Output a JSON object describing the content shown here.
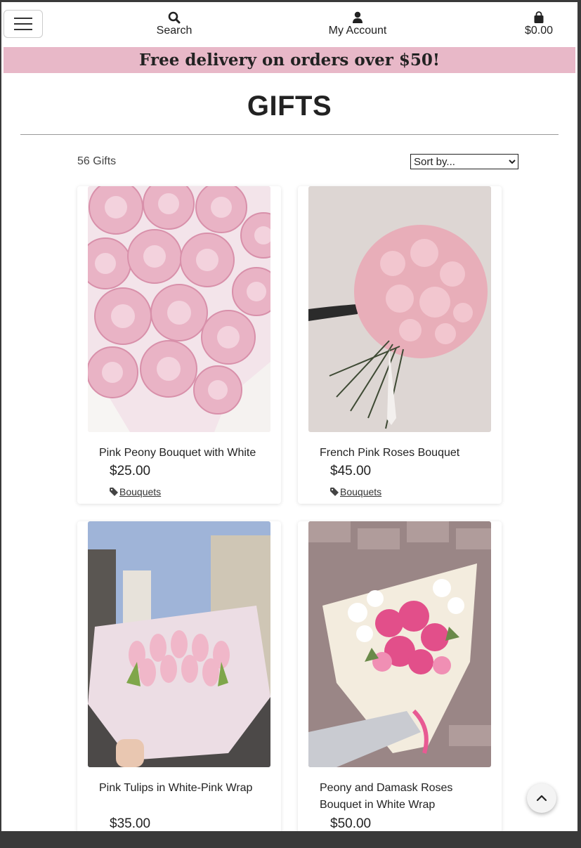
{
  "nav": {
    "search_label": "Search",
    "account_label": "My Account",
    "cart_total": "$0.00"
  },
  "promo": {
    "text": "Free delivery on orders over $50!"
  },
  "page": {
    "title": "GIFTS",
    "count": "56 Gifts"
  },
  "sort": {
    "selected": "Sort by..."
  },
  "products": [
    {
      "name": "Pink Peony Bouquet with White",
      "price": "$25.00",
      "category": "Bouquets"
    },
    {
      "name": "French Pink Roses Bouquet",
      "price": "$45.00",
      "category": "Bouquets"
    },
    {
      "name": "Pink Tulips in White-Pink Wrap",
      "price": "$35.00"
    },
    {
      "name": "Peony and Damask Roses Bouquet in White Wrap",
      "price": "$50.00"
    }
  ],
  "icons": {
    "menu": "hamburger-icon",
    "search": "search-icon",
    "account": "user-icon",
    "cart": "shopping-bag-icon",
    "tag": "tag-icon",
    "to_top": "chevron-up-icon"
  },
  "colors": {
    "promo_bg": "#e8b8c8",
    "text": "#222222"
  }
}
